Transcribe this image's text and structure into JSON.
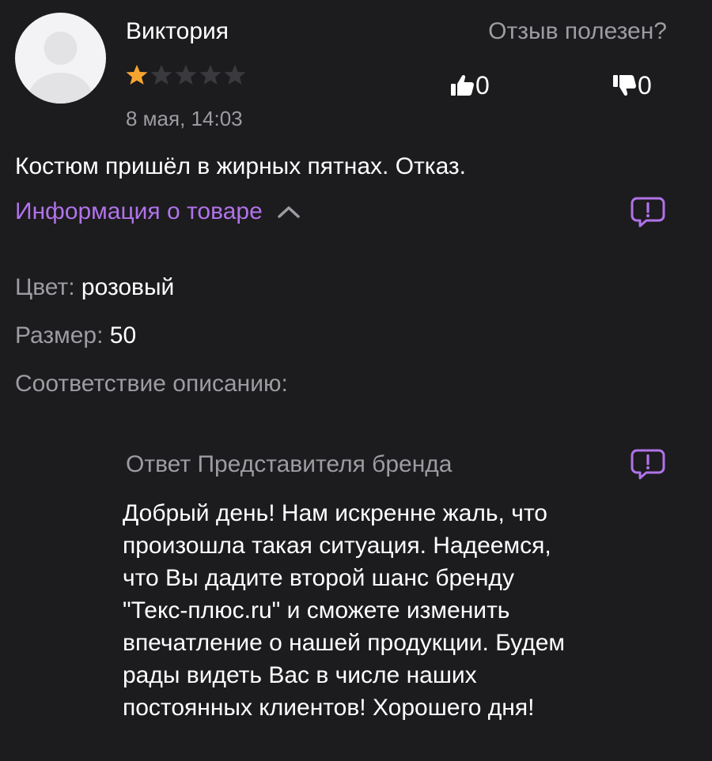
{
  "review": {
    "author": "Виктория",
    "rating": 1,
    "max_rating": 5,
    "date": "8 мая, 14:03",
    "text": "Костюм пришёл в жирных пятнах. Отказ."
  },
  "helpful": {
    "question": "Отзыв полезен?",
    "likes": "0",
    "dislikes": "0"
  },
  "product_info": {
    "toggle_label": "Информация о товаре",
    "expanded": true,
    "color_label": "Цвет:",
    "color_value": "розовый",
    "size_label": "Размер:",
    "size_value": "50",
    "match_label": "Соответствие описанию:"
  },
  "brand_reply": {
    "title": "Ответ Представителя бренда",
    "text": "Добрый день! Нам искренне жаль, что\nпроизошла такая ситуация. Надеемся,\nчто Вы дадите второй шанс бренду\n\"Текс-плюс.ru\" и сможете изменить\nвпечатление о нашей продукции. Будем\nрады видеть Вас в числе наших\nпостоянных клиентов! Хорошего дня!"
  },
  "colors": {
    "background": "#1c1b1e",
    "accent": "#b073e8",
    "star_filled": "#f6a431",
    "star_empty": "#3a393d",
    "muted_text": "#9d9ca1"
  },
  "icons": {
    "avatar": "user-placeholder-icon",
    "like": "thumbs-up-icon",
    "dislike": "thumbs-down-icon",
    "toggle": "chevron-up-icon",
    "report": "report-bubble-icon"
  }
}
